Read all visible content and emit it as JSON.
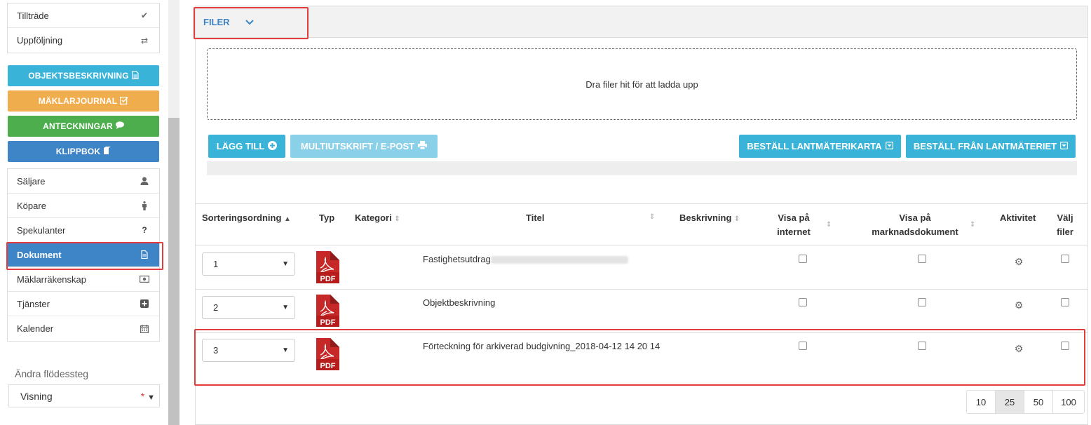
{
  "sidebar": {
    "top_items": [
      {
        "label": "Tillträde",
        "icon": "check-icon"
      },
      {
        "label": "Uppföljning",
        "icon": "exchange-icon"
      }
    ],
    "buttons": [
      {
        "label": "OBJEKTSBESKRIVNING",
        "color": "#39b3d7",
        "icon": "file-icon"
      },
      {
        "label": "MÄKLARJOURNAL",
        "color": "#f0ad4e",
        "icon": "edit-icon"
      },
      {
        "label": "ANTECKNINGAR",
        "color": "#4cae4c",
        "icon": "comment-icon"
      },
      {
        "label": "KLIPPBOK",
        "color": "#3e85c7",
        "icon": "book-icon"
      }
    ],
    "nav_items": [
      {
        "label": "Säljare",
        "icon": "user-icon"
      },
      {
        "label": "Köpare",
        "icon": "male-icon"
      },
      {
        "label": "Spekulanter",
        "icon": "question-icon"
      },
      {
        "label": "Dokument",
        "icon": "document-icon",
        "active": true
      },
      {
        "label": "Mäklarräkenskap",
        "icon": "money-icon"
      },
      {
        "label": "Tjänster",
        "icon": "plus-square-icon"
      },
      {
        "label": "Kalender",
        "icon": "calendar-icon"
      }
    ],
    "flow_heading": "Ändra flödessteg",
    "flow_select": {
      "value": "Visning",
      "required_mark": "*"
    }
  },
  "files": {
    "header": "FILER",
    "dropzone_text": "Dra filer hit för att ladda upp",
    "buttons": {
      "add": "LÄGG TILL",
      "multiprint": "MULTIUTSKRIFT / E-POST",
      "order_map": "BESTÄLL LANTMÄTERIKARTA",
      "order_from": "BESTÄLL FRÅN LANTMÄTERIET"
    },
    "columns": {
      "sort": "Sorteringsordning",
      "type": "Typ",
      "category": "Kategori",
      "title": "Titel",
      "description": "Beskrivning",
      "internet_1": "Visa på",
      "internet_2": "internet",
      "market_1": "Visa på",
      "market_2": "marknadsdokument",
      "activity": "Aktivitet",
      "select_1": "Välj",
      "select_2": "filer"
    },
    "rows": [
      {
        "order": "1",
        "type": "PDF",
        "title": "Fastighetsutdrag"
      },
      {
        "order": "2",
        "type": "PDF",
        "title": "Objektbeskrivning"
      },
      {
        "order": "3",
        "type": "PDF",
        "title": "Förteckning för arkiverad budgivning_2018-04-12 14 20 14"
      }
    ],
    "page_sizes": [
      "10",
      "25",
      "50",
      "100"
    ],
    "active_page_size": "25"
  }
}
